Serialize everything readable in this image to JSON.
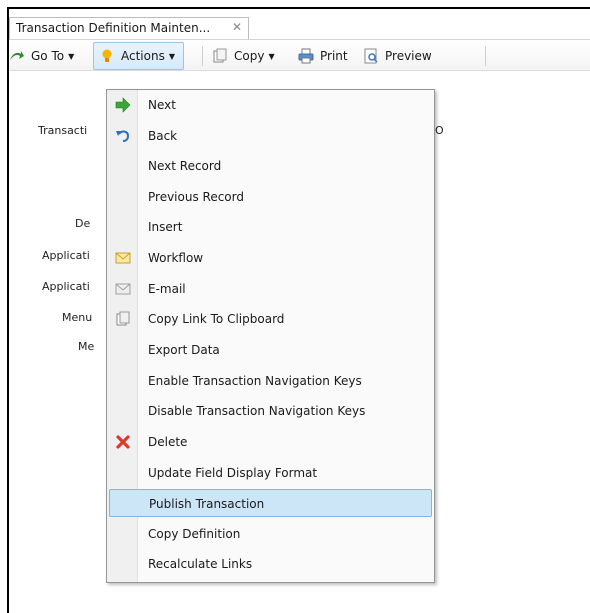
{
  "tab": {
    "title": "Transaction Definition Mainten...",
    "close": "✕"
  },
  "toolbar": {
    "goto_label": "Go To",
    "actions_label": "Actions",
    "copy_label": "Copy",
    "print_label": "Print",
    "preview_label": "Preview"
  },
  "form": {
    "labels": [
      "Transacti",
      "De",
      "Applicati",
      "Applicati",
      "Menu",
      "Me"
    ],
    "partial_value": "O"
  },
  "menu": {
    "items": [
      {
        "label": "Next",
        "icon": "arrow-right-icon"
      },
      {
        "label": "Back",
        "icon": "undo-icon"
      },
      {
        "label": "Next Record",
        "icon": ""
      },
      {
        "label": "Previous Record",
        "icon": ""
      },
      {
        "label": "Insert",
        "icon": ""
      },
      {
        "label": "Workflow",
        "icon": "envelope-icon"
      },
      {
        "label": "E-mail",
        "icon": "email-icon"
      },
      {
        "label": "Copy Link To Clipboard",
        "icon": "clipboard-icon"
      },
      {
        "label": "Export Data",
        "icon": ""
      },
      {
        "label": "Enable Transaction Navigation Keys",
        "icon": ""
      },
      {
        "label": "Disable Transaction Navigation Keys",
        "icon": ""
      },
      {
        "label": "Delete",
        "icon": "delete-x-icon"
      },
      {
        "label": "Update Field Display Format",
        "icon": ""
      },
      {
        "label": "Publish Transaction",
        "icon": "",
        "selected": true
      },
      {
        "label": "Copy Definition",
        "icon": ""
      },
      {
        "label": "Recalculate Links",
        "icon": ""
      }
    ]
  },
  "colors": {
    "accent": "#cde6f7",
    "accent_border": "#7eb4ea",
    "delete": "#e2382b",
    "next": "#3aa635"
  }
}
